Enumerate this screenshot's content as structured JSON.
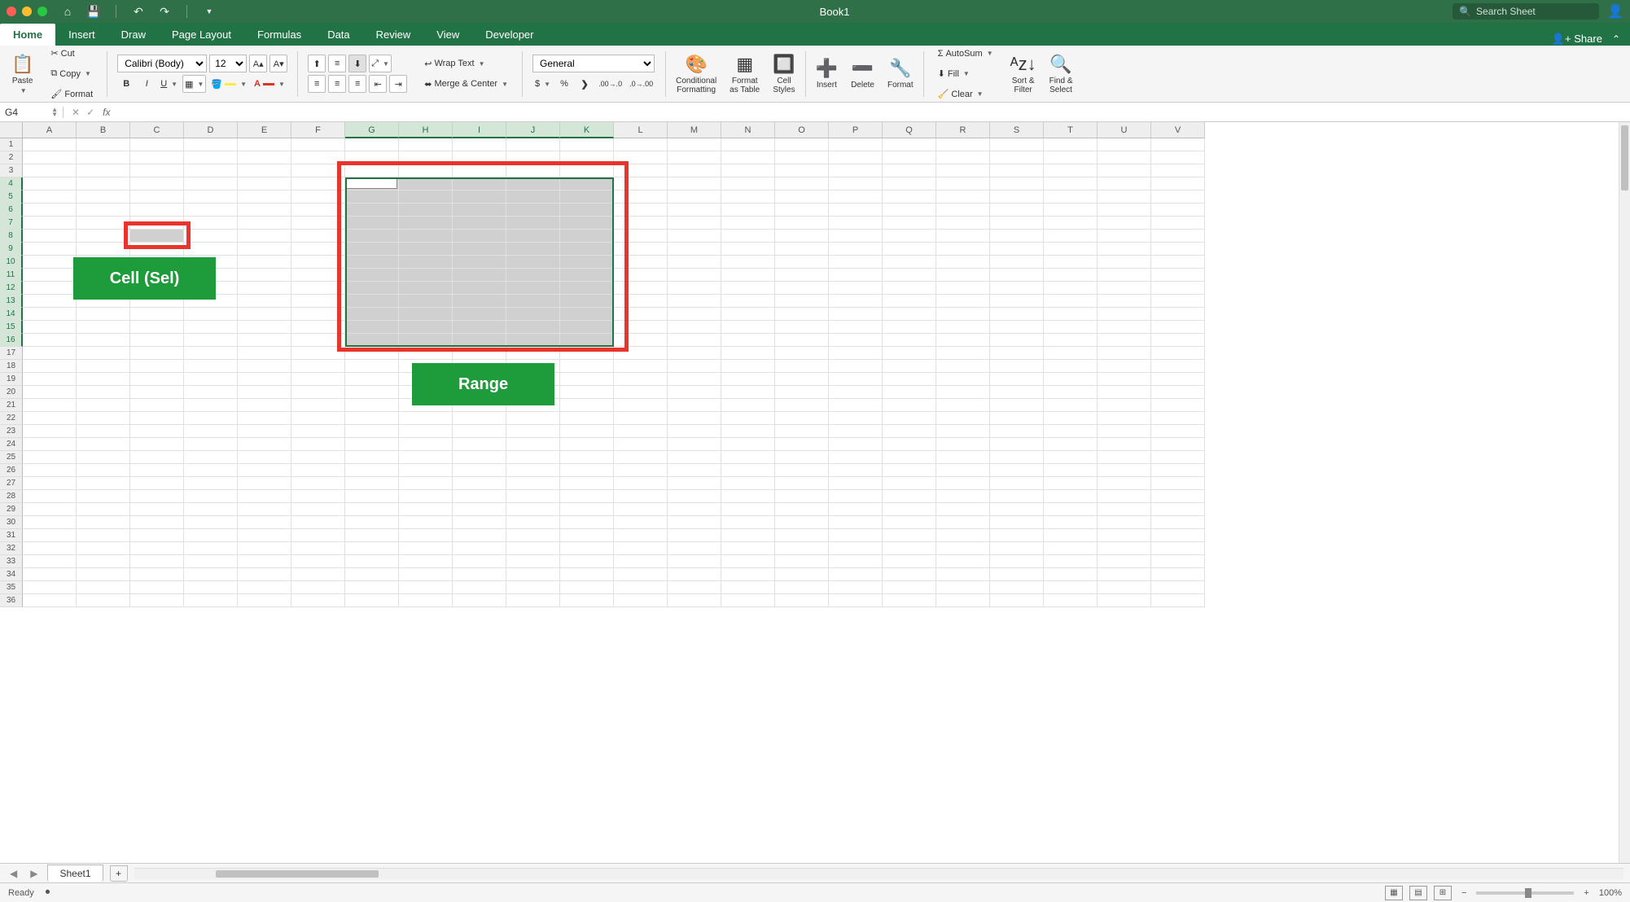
{
  "title": "Book1",
  "search_placeholder": "Search Sheet",
  "tabs": [
    "Home",
    "Insert",
    "Draw",
    "Page Layout",
    "Formulas",
    "Data",
    "Review",
    "View",
    "Developer"
  ],
  "active_tab": "Home",
  "share": "Share",
  "clipboard": {
    "paste": "Paste",
    "cut": "Cut",
    "copy": "Copy",
    "format": "Format"
  },
  "font": {
    "name": "Calibri (Body)",
    "size": "12"
  },
  "alignment": {
    "wrap": "Wrap Text",
    "merge": "Merge & Center"
  },
  "number": {
    "format": "General"
  },
  "styles": {
    "cond": "Conditional\nFormatting",
    "table": "Format\nas Table",
    "cell": "Cell\nStyles"
  },
  "cells_group": {
    "insert": "Insert",
    "delete": "Delete",
    "format": "Format"
  },
  "editing": {
    "autosum": "AutoSum",
    "fill": "Fill",
    "clear": "Clear",
    "sort": "Sort &\nFilter",
    "find": "Find &\nSelect"
  },
  "name_box": "G4",
  "cols": [
    "A",
    "B",
    "C",
    "D",
    "E",
    "F",
    "G",
    "H",
    "I",
    "J",
    "K",
    "L",
    "M",
    "N",
    "O",
    "P",
    "Q",
    "R",
    "S",
    "T",
    "U",
    "V"
  ],
  "row_count": 36,
  "selected_cols": [
    "G",
    "H",
    "I",
    "J",
    "K"
  ],
  "selected_rows_start": 4,
  "selected_rows_end": 16,
  "single_cell_col": "C",
  "single_cell_row": 8,
  "annot_cell_label": "Cell (Sel)",
  "annot_range_label": "Range",
  "sheet_name": "Sheet1",
  "status": "Ready",
  "zoom": "100%"
}
